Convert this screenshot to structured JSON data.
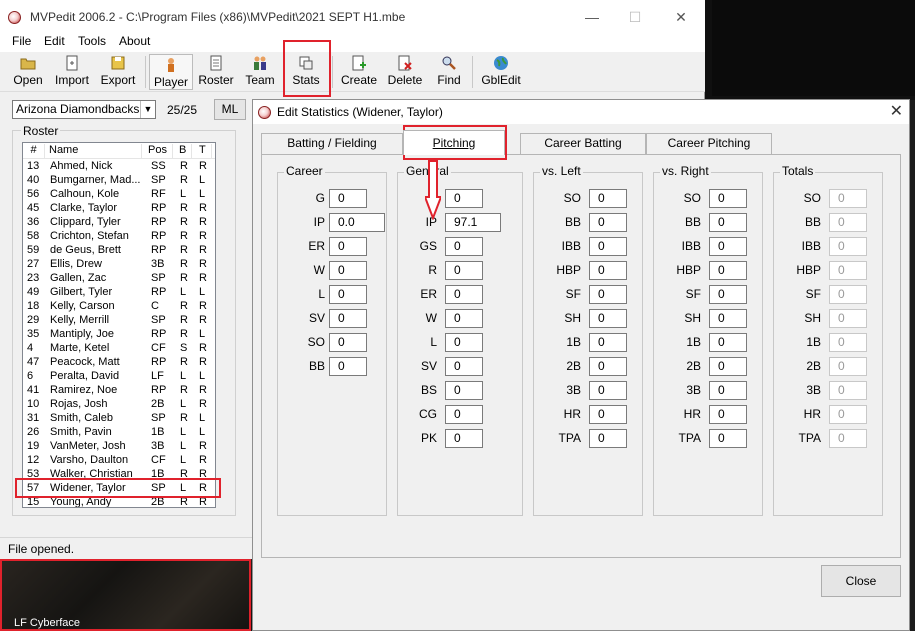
{
  "main_window": {
    "title": "MVPedit 2006.2 - C:\\Program Files (x86)\\MVPedit\\2021 SEPT H1.mbe",
    "menu": [
      "File",
      "Edit",
      "Tools",
      "About"
    ],
    "toolbar": {
      "open": "Open",
      "import": "Import",
      "export": "Export",
      "player": "Player",
      "roster": "Roster",
      "team": "Team",
      "stats": "Stats",
      "create": "Create",
      "delete": "Delete",
      "find": "Find",
      "gbledit": "GblEdit"
    },
    "team_select": "Arizona Diamondbacks",
    "roster_count": "25/25",
    "ml_button": "ML",
    "roster_label": "Roster",
    "roster_columns": [
      "#",
      "Name",
      "Pos",
      "B",
      "T"
    ],
    "roster": [
      [
        "13",
        "Ahmed, Nick",
        "SS",
        "R",
        "R"
      ],
      [
        "40",
        "Bumgarner, Mad...",
        "SP",
        "R",
        "L"
      ],
      [
        "56",
        "Calhoun, Kole",
        "RF",
        "L",
        "L"
      ],
      [
        "45",
        "Clarke, Taylor",
        "RP",
        "R",
        "R"
      ],
      [
        "36",
        "Clippard, Tyler",
        "RP",
        "R",
        "R"
      ],
      [
        "58",
        "Crichton, Stefan",
        "RP",
        "R",
        "R"
      ],
      [
        "59",
        "de Geus, Brett",
        "RP",
        "R",
        "R"
      ],
      [
        "27",
        "Ellis, Drew",
        "3B",
        "R",
        "R"
      ],
      [
        "23",
        "Gallen, Zac",
        "SP",
        "R",
        "R"
      ],
      [
        "49",
        "Gilbert, Tyler",
        "RP",
        "L",
        "L"
      ],
      [
        "18",
        "Kelly, Carson",
        "C",
        "R",
        "R"
      ],
      [
        "29",
        "Kelly, Merrill",
        "SP",
        "R",
        "R"
      ],
      [
        "35",
        "Mantiply, Joe",
        "RP",
        "R",
        "L"
      ],
      [
        "4",
        "Marte, Ketel",
        "CF",
        "S",
        "R"
      ],
      [
        "47",
        "Peacock, Matt",
        "RP",
        "R",
        "R"
      ],
      [
        "6",
        "Peralta, David",
        "LF",
        "L",
        "L"
      ],
      [
        "41",
        "Ramirez, Noe",
        "RP",
        "R",
        "R"
      ],
      [
        "10",
        "Rojas, Josh",
        "2B",
        "L",
        "R"
      ],
      [
        "31",
        "Smith, Caleb",
        "SP",
        "R",
        "L"
      ],
      [
        "26",
        "Smith, Pavin",
        "1B",
        "L",
        "L"
      ],
      [
        "19",
        "VanMeter, Josh",
        "3B",
        "L",
        "R"
      ],
      [
        "12",
        "Varsho, Daulton",
        "CF",
        "L",
        "R"
      ],
      [
        "53",
        "Walker, Christian",
        "1B",
        "R",
        "R"
      ],
      [
        "57",
        "Widener, Taylor",
        "SP",
        "L",
        "R"
      ],
      [
        "15",
        "Young, Andy",
        "2B",
        "R",
        "R"
      ]
    ],
    "status": "File opened."
  },
  "taskbar_label": "LF Cyberface",
  "dialog": {
    "title": "Edit Statistics (Widener, Taylor)",
    "tabs": [
      "Batting / Fielding",
      "Pitching",
      "Career Batting",
      "Career Pitching"
    ],
    "career": {
      "label": "Career",
      "fields": [
        [
          "G",
          "0"
        ],
        [
          "IP",
          "0.0"
        ],
        [
          "ER",
          "0"
        ],
        [
          "W",
          "0"
        ],
        [
          "L",
          "0"
        ],
        [
          "SV",
          "0"
        ],
        [
          "SO",
          "0"
        ],
        [
          "BB",
          "0"
        ]
      ]
    },
    "general": {
      "label": "General",
      "fields": [
        [
          "G",
          "0"
        ],
        [
          "IP",
          "97.1"
        ],
        [
          "GS",
          "0"
        ],
        [
          "R",
          "0"
        ],
        [
          "ER",
          "0"
        ],
        [
          "W",
          "0"
        ],
        [
          "L",
          "0"
        ],
        [
          "SV",
          "0"
        ],
        [
          "BS",
          "0"
        ],
        [
          "CG",
          "0"
        ],
        [
          "PK",
          "0"
        ]
      ]
    },
    "vs_left": {
      "label": "vs. Left",
      "fields": [
        [
          "SO",
          "0"
        ],
        [
          "BB",
          "0"
        ],
        [
          "IBB",
          "0"
        ],
        [
          "HBP",
          "0"
        ],
        [
          "SF",
          "0"
        ],
        [
          "SH",
          "0"
        ],
        [
          "1B",
          "0"
        ],
        [
          "2B",
          "0"
        ],
        [
          "3B",
          "0"
        ],
        [
          "HR",
          "0"
        ],
        [
          "TPA",
          "0"
        ]
      ]
    },
    "vs_right": {
      "label": "vs. Right",
      "fields": [
        [
          "SO",
          "0"
        ],
        [
          "BB",
          "0"
        ],
        [
          "IBB",
          "0"
        ],
        [
          "HBP",
          "0"
        ],
        [
          "SF",
          "0"
        ],
        [
          "SH",
          "0"
        ],
        [
          "1B",
          "0"
        ],
        [
          "2B",
          "0"
        ],
        [
          "3B",
          "0"
        ],
        [
          "HR",
          "0"
        ],
        [
          "TPA",
          "0"
        ]
      ]
    },
    "totals": {
      "label": "Totals",
      "fields": [
        [
          "SO",
          "0"
        ],
        [
          "BB",
          "0"
        ],
        [
          "IBB",
          "0"
        ],
        [
          "HBP",
          "0"
        ],
        [
          "SF",
          "0"
        ],
        [
          "SH",
          "0"
        ],
        [
          "1B",
          "0"
        ],
        [
          "2B",
          "0"
        ],
        [
          "3B",
          "0"
        ],
        [
          "HR",
          "0"
        ],
        [
          "TPA",
          "0"
        ]
      ]
    },
    "close_button": "Close"
  },
  "colors": {
    "highlight": "#e0222c"
  }
}
